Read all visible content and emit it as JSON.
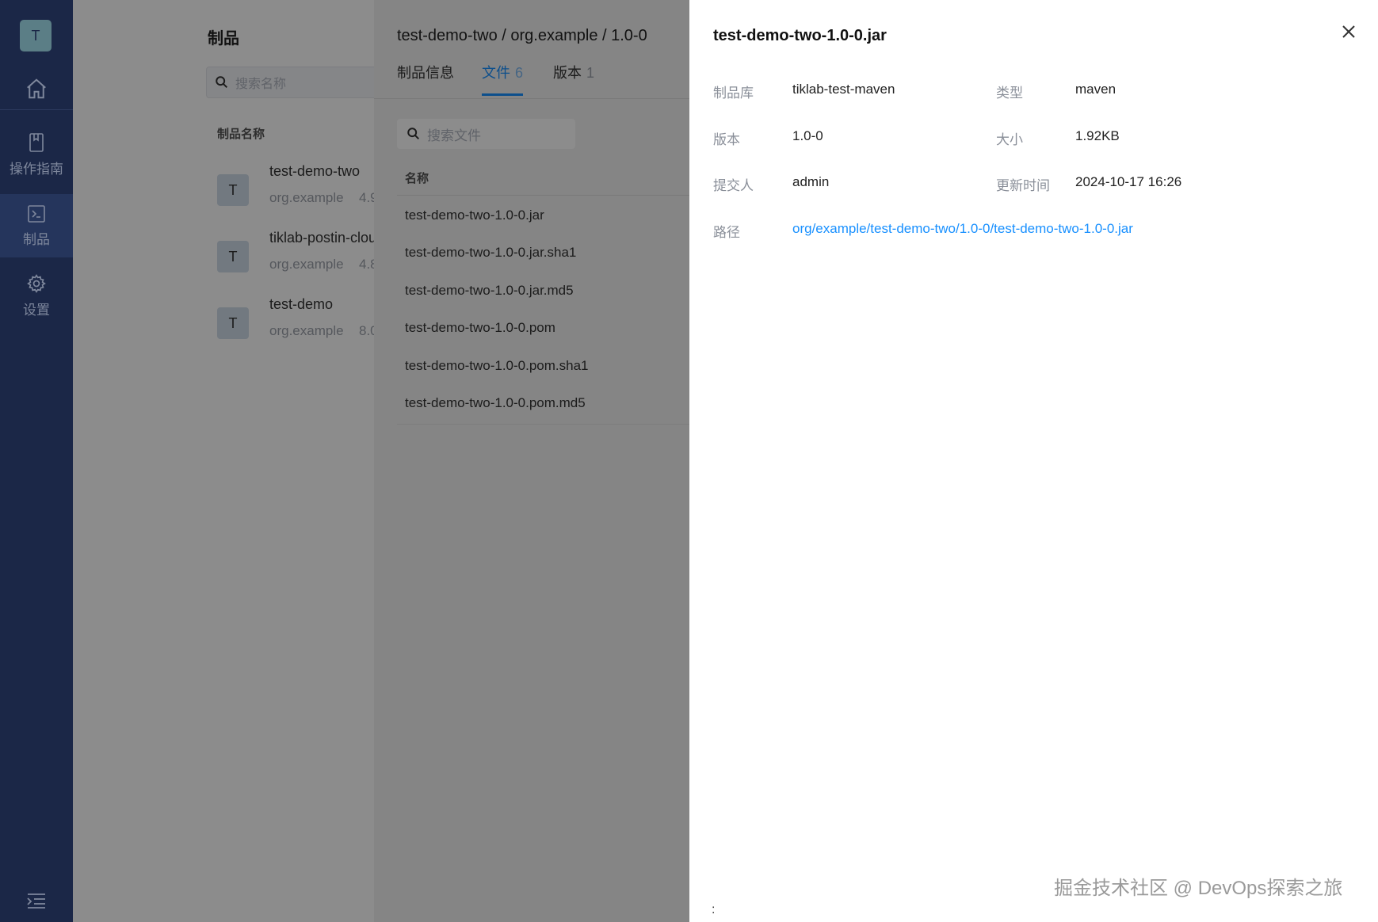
{
  "nav": {
    "logo_letter": "T",
    "items": [
      {
        "label": "操作指南",
        "icon": "book-icon"
      },
      {
        "label": "制品",
        "icon": "terminal-icon",
        "active": true
      },
      {
        "label": "设置",
        "icon": "gear-icon"
      }
    ]
  },
  "products": {
    "title": "制品",
    "search_placeholder": "搜索名称",
    "column_header": "制品名称",
    "items": [
      {
        "avatar": "T",
        "name": "test-demo-two",
        "group": "org.example",
        "size": "4.9"
      },
      {
        "avatar": "T",
        "name": "tiklab-postin-clou",
        "group": "org.example",
        "size": "4.8"
      },
      {
        "avatar": "T",
        "name": "test-demo",
        "group": "org.example",
        "size": "8.0"
      }
    ]
  },
  "files": {
    "breadcrumb": "test-demo-two / org.example / 1.0-0",
    "tabs": [
      {
        "label": "制品信息",
        "count": ""
      },
      {
        "label": "文件",
        "count": "6",
        "active": true
      },
      {
        "label": "版本",
        "count": "1"
      }
    ],
    "search_placeholder": "搜索文件",
    "column_header": "名称",
    "items": [
      "test-demo-two-1.0-0.jar",
      "test-demo-two-1.0-0.jar.sha1",
      "test-demo-two-1.0-0.jar.md5",
      "test-demo-two-1.0-0.pom",
      "test-demo-two-1.0-0.pom.sha1",
      "test-demo-two-1.0-0.pom.md5"
    ]
  },
  "drawer": {
    "title": "test-demo-two-1.0-0.jar",
    "fields": {
      "repo_label": "制品库",
      "repo_value": "tiklab-test-maven",
      "type_label": "类型",
      "type_value": "maven",
      "version_label": "版本",
      "version_value": "1.0-0",
      "size_label": "大小",
      "size_value": "1.92KB",
      "submitter_label": "提交人",
      "submitter_value": "admin",
      "updated_label": "更新时间",
      "updated_value": "2024-10-17 16:26",
      "path_label": "路径",
      "path_value": "org/example/test-demo-two/1.0-0/test-demo-two-1.0-0.jar"
    }
  },
  "watermark": "掘金技术社区 @ DevOps探索之旅",
  "footer_colon": ":",
  "colors": {
    "nav_bg": "#1b2747",
    "accent": "#1890ff",
    "mask": "rgba(0,0,0,0.45)"
  }
}
